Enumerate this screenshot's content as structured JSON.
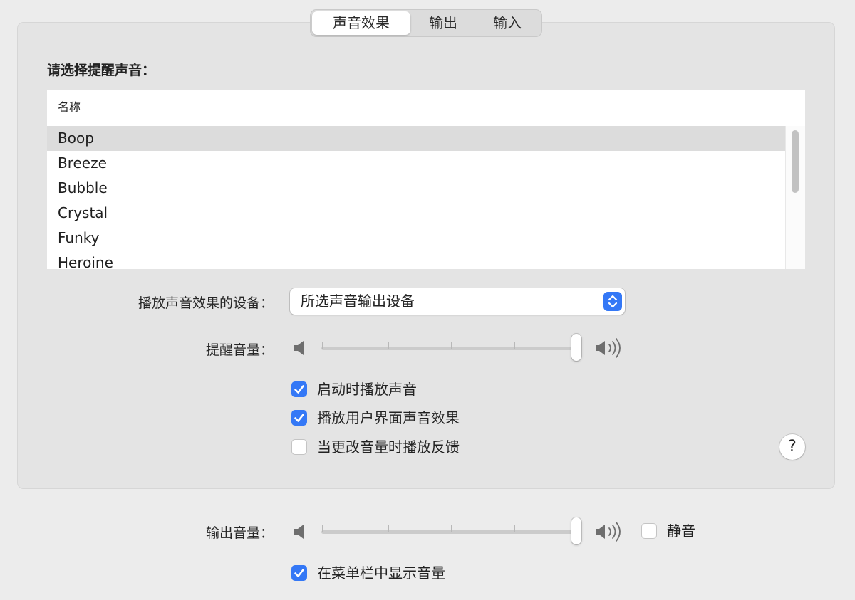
{
  "tabs": [
    {
      "label": "声音效果",
      "active": true
    },
    {
      "label": "输出",
      "active": false
    },
    {
      "label": "输入",
      "active": false
    }
  ],
  "alert_sound": {
    "section_title": "请选择提醒声音：",
    "column_header": "名称",
    "items": [
      "Boop",
      "Breeze",
      "Bubble",
      "Crystal",
      "Funky",
      "Heroine"
    ],
    "selected": "Boop"
  },
  "device": {
    "label": "播放声音效果的设备：",
    "value": "所选声音输出设备"
  },
  "alert_volume": {
    "label": "提醒音量：",
    "level": 1.0
  },
  "options": [
    {
      "label": "启动时播放声音",
      "checked": true
    },
    {
      "label": "播放用户界面声音效果",
      "checked": true
    },
    {
      "label": "当更改音量时播放反馈",
      "checked": false
    }
  ],
  "help": {
    "symbol": "?"
  },
  "output_volume": {
    "label": "输出音量：",
    "level": 1.0,
    "mute_label": "静音",
    "muted": false
  },
  "menubar": {
    "label": "在菜单栏中显示音量",
    "checked": true
  },
  "colors": {
    "accent": "#3478f6",
    "selection": "#dcdcdc",
    "panel": "#e4e4e4",
    "window": "#ececec"
  }
}
